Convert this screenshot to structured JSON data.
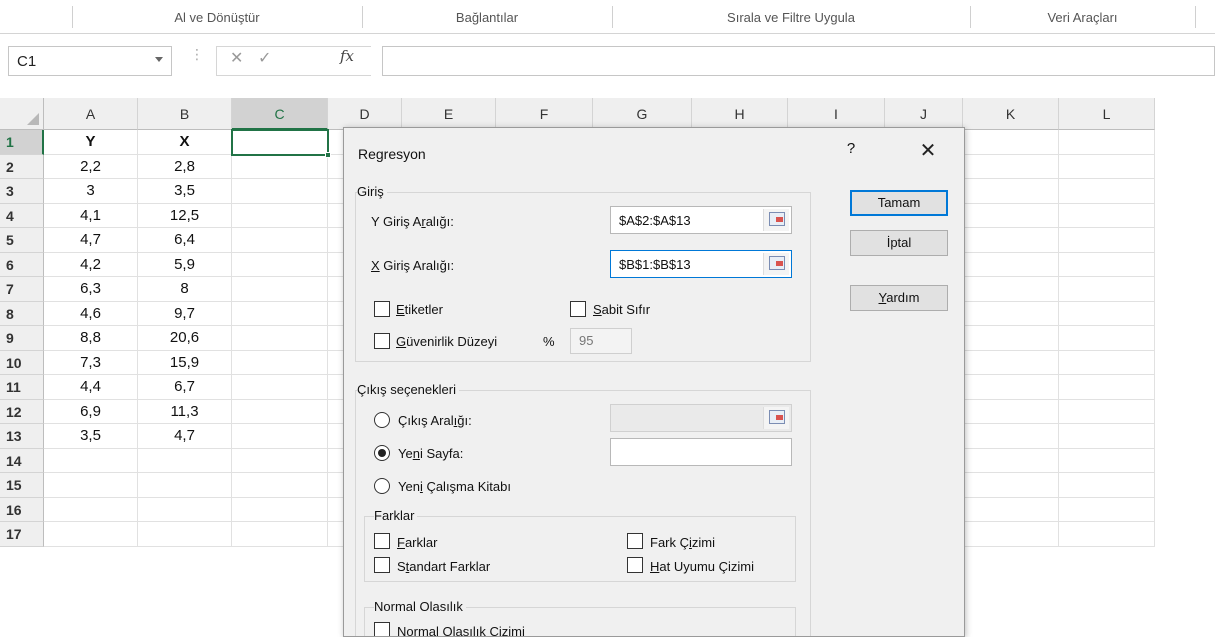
{
  "ribbon": {
    "groups": [
      "Al ve Dönüştür",
      "Bağlantılar",
      "Sırala ve Filtre Uygula",
      "Veri Araçları"
    ]
  },
  "formula_bar": {
    "name_box": "C1",
    "fx_label": "fx",
    "cancel_glyph": "✕",
    "enter_glyph": "✓",
    "formula": ""
  },
  "sheet": {
    "columns": [
      "A",
      "B",
      "C",
      "D",
      "E",
      "F",
      "G",
      "H",
      "I",
      "J",
      "K",
      "L"
    ],
    "rows": [
      "1",
      "2",
      "3",
      "4",
      "5",
      "6",
      "7",
      "8",
      "9",
      "10",
      "11",
      "12",
      "13",
      "14",
      "15",
      "16",
      "17"
    ],
    "selected_cell": "C1",
    "data": [
      [
        "Y",
        "X"
      ],
      [
        "2,2",
        "2,8"
      ],
      [
        "3",
        "3,5"
      ],
      [
        "4,1",
        "12,5"
      ],
      [
        "4,7",
        "6,4"
      ],
      [
        "4,2",
        "5,9"
      ],
      [
        "6,3",
        "8"
      ],
      [
        "4,6",
        "9,7"
      ],
      [
        "8,8",
        "20,6"
      ],
      [
        "7,3",
        "15,9"
      ],
      [
        "4,4",
        "6,7"
      ],
      [
        "6,9",
        "11,3"
      ],
      [
        "3,5",
        "4,7"
      ]
    ]
  },
  "dialog": {
    "title": "Regresyon",
    "help": "?",
    "close": "✕",
    "input_group": {
      "label": "Giriş",
      "y_range_label_a": "Y Giriş A",
      "y_range_label_u": "r",
      "y_range_label_b": "alığı:",
      "y_range_value": "$A$2:$A$13",
      "x_range_label_u": "X",
      "x_range_label_b": " Giriş Aralığı:",
      "x_range_value": "$B$1:$B$13",
      "labels_u": "E",
      "labels_rest": "tiketler",
      "constant_zero_u": "S",
      "constant_zero_rest": "abit Sıfır",
      "confidence_u": "G",
      "confidence_rest": "üvenirlik Düzeyi",
      "confidence_pct": "%",
      "confidence_value": "95"
    },
    "output_group": {
      "label": "Çıkış seçenekleri",
      "output_range_a": "Çıkış Aral",
      "output_range_u": "ı",
      "output_range_b": "ğı:",
      "new_sheet_a": "Ye",
      "new_sheet_u": "n",
      "new_sheet_b": "i Sayfa:",
      "new_workbook_a": "Yen",
      "new_workbook_u": "i",
      "new_workbook_b": " Çalışma Kitabı",
      "selected_option": "new_sheet"
    },
    "residuals_group": {
      "label": "Farklar",
      "residuals_u": "F",
      "residuals_rest": "arklar",
      "std_residuals_a": "S",
      "std_residuals_u": "t",
      "std_residuals_b": "andart Farklar",
      "residual_plots_a": "Fark Ç",
      "residual_plots_u": "i",
      "residual_plots_b": "zimi",
      "line_fit_u": "H",
      "line_fit_rest": "at Uyumu Çizimi"
    },
    "normal_group": {
      "label": "Normal Olasılık",
      "normal_plots": "Normal Olasılık Çizimi"
    },
    "buttons": {
      "ok": "Tamam",
      "cancel": "İptal",
      "help_u": "Y",
      "help_rest": "ardım"
    }
  }
}
